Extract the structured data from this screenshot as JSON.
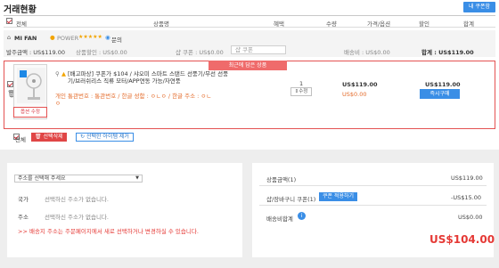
{
  "page": {
    "title": "거래현황",
    "coupon_box_label": "내 쿠폰함"
  },
  "table_header": {
    "select_all": "전체",
    "product": "상품명",
    "benefit": "혜택",
    "qty": "수량",
    "price_option": "가격/옵션",
    "discount": "할인",
    "total": "합계"
  },
  "seller": {
    "name": "MI FAN",
    "power": "POWER",
    "rating_stars": 5,
    "stars_text": "★★★★★",
    "inquiry": "문의",
    "order_amount": "발주금액 : US$119.00",
    "product_discount": "상품할인 : US$0.00",
    "coupon": "샵 쿠폰 : US$0.00",
    "coupon_select": "샵 쿠폰",
    "shipping": "배송비 : US$0.00",
    "total": "합계 : US$119.00"
  },
  "item": {
    "recent_badge": "최근에 담은 상품",
    "title": "[배고파상] 쿠폰가 $104 / 샤오미 스마트 스탠드 선풍기/무선 선풍기/브러쉬리스 직류 모터/APP연동 가능/자연풍",
    "option": "개인 통관번호 : 통관번호 / 한글 성함 : ㅇㄴㅇ / 한글 주소 : ㅇㄴㅇ",
    "option_button": "옵션 수정",
    "qty": "1",
    "qty_button": "수정",
    "price": "US$119.00",
    "discount": "US$0.00",
    "total": "US$119.00",
    "buy_button": "즉시구매"
  },
  "actions": {
    "select_all": "전체",
    "delete_selected": "선택삭제",
    "delete_invalid": "선택한 아이템 제거"
  },
  "address": {
    "select": "주소를 선택해 주세요",
    "country_label": "국가",
    "country_value": "선택하신 주소가 없습니다.",
    "address_label": "주소",
    "address_value": "선택하신 주소가 없습니다.",
    "notice": ">> 배송지 주소는 주문페이지에서 새로 선택하거나 변경하실 수 있습니다."
  },
  "summary": {
    "product_amount_label": "상품금액(1)",
    "product_amount": "US$119.00",
    "cart_coupon_label": "샵/장바구니 쿠폰(1)",
    "apply_coupon": "쿠폰 적용하기",
    "cart_coupon": "-US$15.00",
    "shipping_label": "배송비합계",
    "shipping": "US$0.00",
    "grand_total": "US$104.00"
  },
  "colors": {
    "accent_blue": "#3a8ee6",
    "accent_red": "#e53935",
    "highlight_border": "#e45252"
  }
}
